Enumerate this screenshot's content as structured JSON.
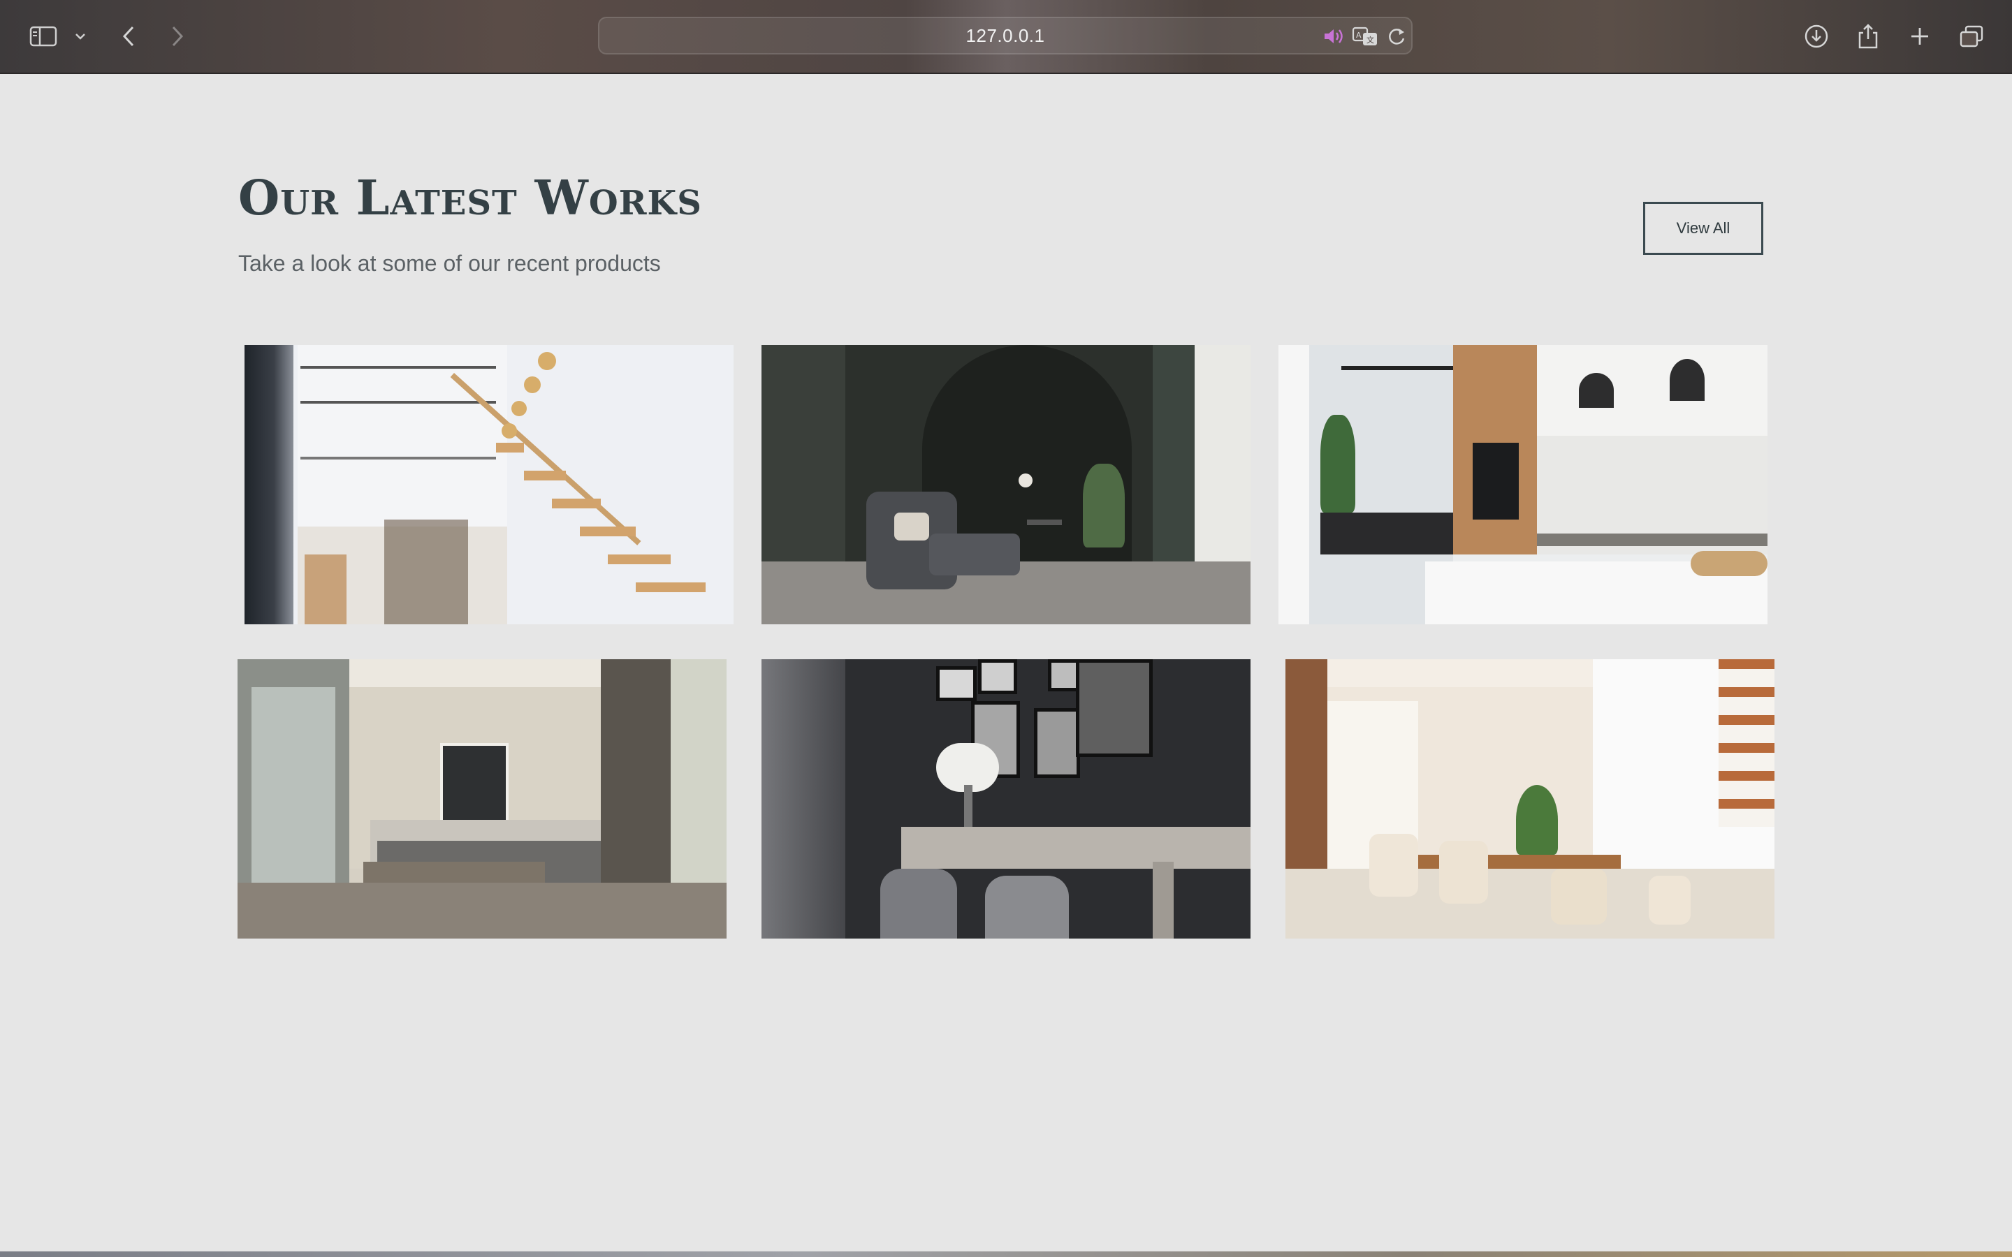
{
  "browser": {
    "url": "127.0.0.1",
    "icons": [
      "sidebar-icon",
      "chevron-down-icon",
      "back-icon",
      "forward-icon",
      "speaker-icon",
      "translate-icon",
      "reload-icon",
      "download-icon",
      "share-icon",
      "new-tab-icon",
      "tabs-overview-icon"
    ]
  },
  "section": {
    "title": "Our Latest Works",
    "subtitle": "Take a look at some of our recent products",
    "view_all_label": "View All"
  },
  "gallery": {
    "items": [
      {
        "subject": "staircase"
      },
      {
        "subject": "armchair-room"
      },
      {
        "subject": "kitchen"
      },
      {
        "subject": "bedroom"
      },
      {
        "subject": "dining-dark"
      },
      {
        "subject": "dining-bright"
      }
    ]
  },
  "colors": {
    "page_bg": "#e6e6e6",
    "title": "#344045",
    "subtitle": "#5b6165",
    "button_border": "#3b4a50"
  }
}
